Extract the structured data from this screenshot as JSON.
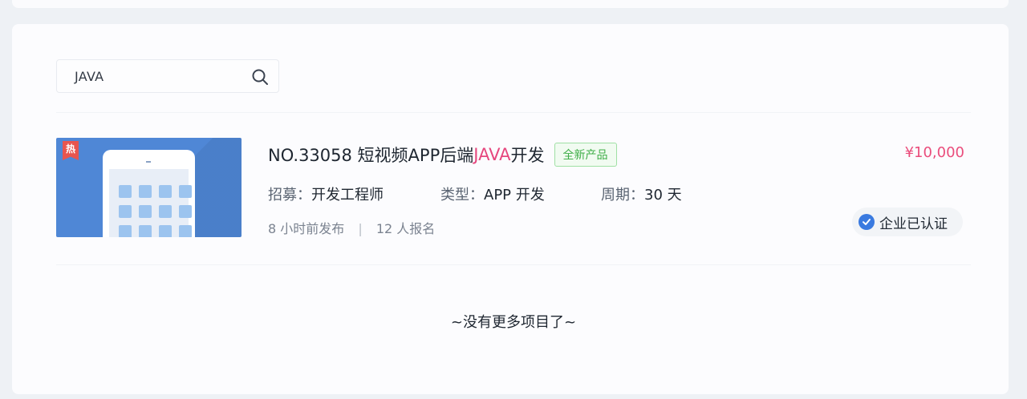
{
  "search": {
    "value": "JAVA"
  },
  "project": {
    "badge": "热",
    "title_prefix": "NO.33058  短视频APP后端",
    "title_highlight": "JAVA",
    "title_suffix": "开发",
    "tag": "全新产品",
    "price": "¥10,000",
    "recruit_label": "招募：",
    "recruit_value": "开发工程师",
    "type_label": "类型：",
    "type_value": "APP 开发",
    "period_label": "周期：",
    "period_value": "30 天",
    "posted": "8 小时前发布",
    "separator": "|",
    "signups": "12 人报名",
    "verified": "企业已认证"
  },
  "footer": {
    "no_more": "~没有更多项目了~"
  },
  "colors": {
    "accent_pink": "#e6477e",
    "tag_green": "#3fae48",
    "verified_blue": "#3a7ae0"
  }
}
